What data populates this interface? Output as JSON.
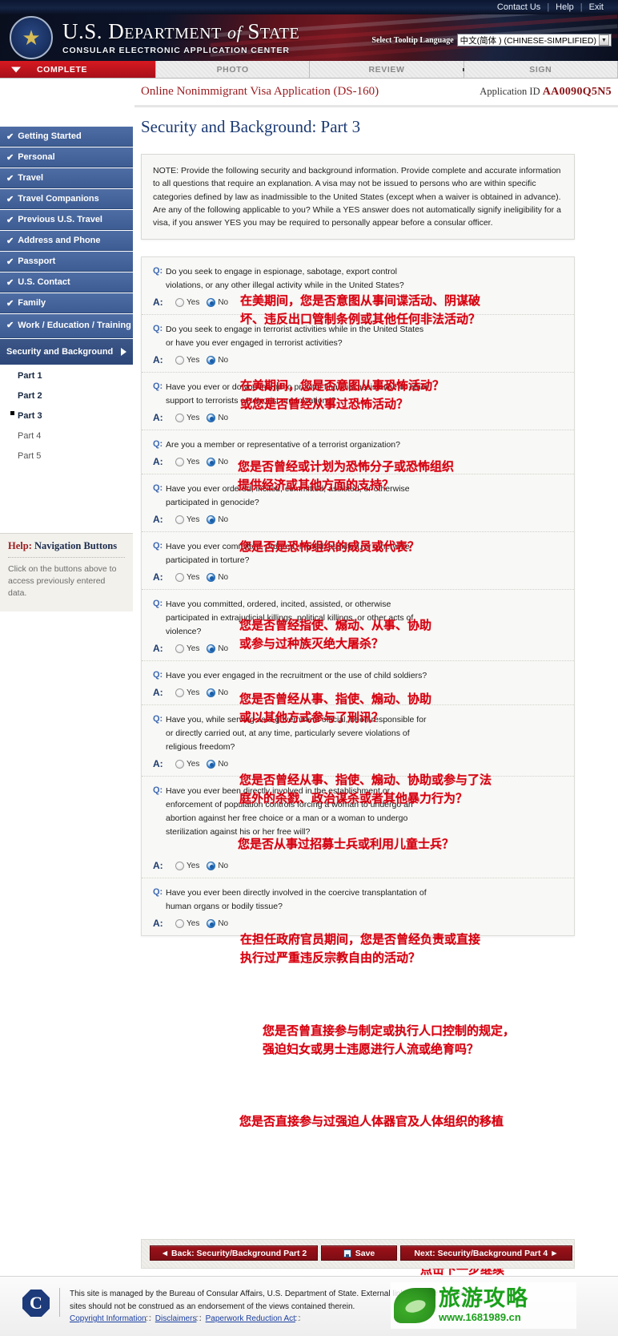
{
  "topbar": {
    "links": [
      "Contact Us",
      "Help",
      "Exit"
    ]
  },
  "banner": {
    "title_line1_a": "U.S. D",
    "title_line1_b": "EPARTMENT",
    "title_line1_of": "of",
    "title_line1_c": "S",
    "title_line1_d": "TATE",
    "subtitle": "CONSULAR ELECTRONIC APPLICATION CENTER",
    "tooltip_label": "Select Tooltip Language",
    "tooltip_value": "中文(简体 ) (CHINESE-SIMPLIFIED)",
    "seal_icon": "department-seal-icon"
  },
  "steptabs": [
    {
      "label": "COMPLETE",
      "active": true
    },
    {
      "label": "PHOTO",
      "active": false
    },
    {
      "label": "REVIEW",
      "active": false
    },
    {
      "label": "SIGN",
      "active": false
    }
  ],
  "apptitle": {
    "form_name": "Online Nonimmigrant Visa Application (DS-160)",
    "appid_label": "Application ID",
    "appid_value": "AA0090Q5N5"
  },
  "page_heading": "Security and Background: Part 3",
  "note": "NOTE: Provide the following security and background information. Provide complete and accurate information to all questions that require an explanation. A visa may not be issued to persons who are within specific categories defined by law as inadmissible to the United States (except when a waiver is obtained in advance). Are any of the following applicable to you? While a YES answer does not automatically signify ineligibility for a visa, if you answer YES you may be required to personally appear before a consular officer.",
  "sidebar": {
    "items": [
      {
        "label": "Getting Started",
        "done": true
      },
      {
        "label": "Personal",
        "done": true
      },
      {
        "label": "Travel",
        "done": true
      },
      {
        "label": "Travel Companions",
        "done": true
      },
      {
        "label": "Previous U.S. Travel",
        "done": true
      },
      {
        "label": "Address and Phone",
        "done": true
      },
      {
        "label": "Passport",
        "done": true
      },
      {
        "label": "U.S. Contact",
        "done": true
      },
      {
        "label": "Family",
        "done": true
      },
      {
        "label": "Work / Education / Training",
        "done": true
      }
    ],
    "current": "Security and Background",
    "subitems": [
      {
        "label": "Part 1",
        "selected": false
      },
      {
        "label": "Part 2",
        "selected": false
      },
      {
        "label": "Part 3",
        "selected": true
      },
      {
        "label": "Part 4",
        "selected": false
      },
      {
        "label": "Part 5",
        "selected": false
      }
    ],
    "help": {
      "title_red": "Help:",
      "title_rest": " Navigation Buttons",
      "body": "Click on the buttons above to access previously entered data."
    }
  },
  "answer_labels": {
    "q": "Q:",
    "a": "A:",
    "yes": "Yes",
    "no": "No"
  },
  "questions": [
    {
      "text": "Do you seek to engage in espionage, sabotage, export control violations, or any other illegal activity while in the United States?",
      "answer": "No"
    },
    {
      "text": "Do you seek to engage in terrorist activities while in the United States or have you ever engaged in terrorist activities?",
      "answer": "No"
    },
    {
      "text": "Have you ever or do you intend to provide financial assistance or other support to terrorists or terrorist organizations?",
      "answer": "No"
    },
    {
      "text": "Are you a member or representative of a terrorist organization?",
      "answer": "No"
    },
    {
      "text": "Have you ever ordered, incited, committed, assisted, or otherwise participated in genocide?",
      "answer": "No"
    },
    {
      "text": "Have you ever committed, ordered, incited, assisted, or otherwise participated in torture?",
      "answer": "No"
    },
    {
      "text": "Have you committed, ordered, incited, assisted, or otherwise participated in extrajudicial killings, political killings, or other acts of violence?",
      "answer": "No"
    },
    {
      "text": "Have you ever engaged in the recruitment or the use of child soldiers?",
      "answer": "No"
    },
    {
      "text": "Have you, while serving as a government official, been responsible for or directly carried out, at any time, particularly severe violations of religious freedom?",
      "answer": "No"
    },
    {
      "text": "Have you ever been directly involved in the establishment or enforcement of population controls forcing a woman to undergo an abortion against her free choice or a man or a woman to undergo sterilization against his or her free will?",
      "answer": "No"
    },
    {
      "text": "Have you ever been directly involved in the coercive transplantation of human organs or bodily tissue?",
      "answer": "No"
    }
  ],
  "annotations": {
    "color": "#d7000f",
    "items": [
      "在美期间，您是否意图从事间谍活动、阴谋破\n坏、违反出口管制条例或其他任何非法活动？",
      "在美期间，您是否意图从事恐怖活动？\n或您是否曾经从事过恐怖活动？",
      "您是否曾经或计划为恐怖分子或恐怖组织\n提供经济或其他方面的支持？",
      "您是否是恐怖组织的成员或代表？",
      "您是否曾经指使、煽动、从事、协助\n或参与过种族灭绝大屠杀？",
      "您是否曾经从事、指使、煽动、协助\n或以其他方式参与了刑讯？",
      "您是否曾经从事、指使、煽动、协助或参与了法\n庭外的杀戮、政治谋杀或者其他暴力行为？",
      "您是否从事过招募士兵或利用儿童士兵？",
      "在担任政府官员期间，您是否曾经负责或直接\n执行过严重违反宗教自由的活动？",
      "您是否曾直接参与制定或执行人口控制的规定，\n强迫妇女或男士违愿进行人流或绝育吗？",
      "您是否直接参与过强迫人体器官及人体组织的移植",
      "点击下一步继续"
    ]
  },
  "buttons": {
    "back": "◄ Back: Security/Background Part 2",
    "save": "Save",
    "save_icon": "floppy-disk-icon",
    "next": "Next: Security/Background Part 4 ►"
  },
  "footer": {
    "seal_icon": "consular-affairs-seal-icon",
    "line1": "This site is managed by the Bureau of Consular Affairs, U.S. Department of State. External links to other Internet",
    "line2": "sites should not be construed as an endorsement of the views contained therein.",
    "links": [
      "Copyright Information",
      "Disclaimers",
      "Paperwork Reduction Act"
    ]
  },
  "watermark": {
    "cn_text": "旅游攻略",
    "url": "www.1681989.cn"
  }
}
